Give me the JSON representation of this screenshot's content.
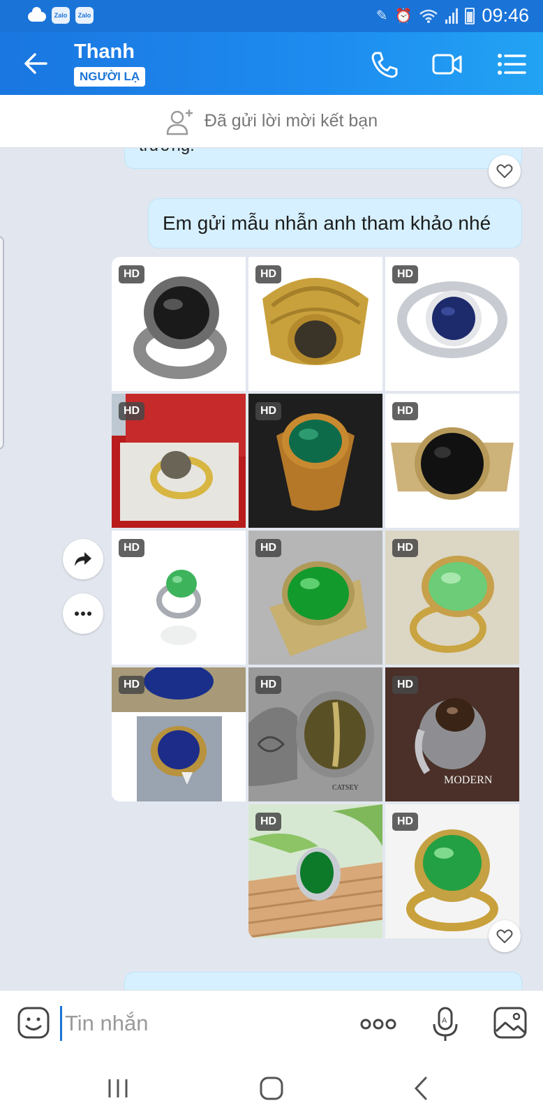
{
  "status_bar": {
    "time": "09:46",
    "app_icon_1": "Zalo",
    "app_icon_2": "Zalo"
  },
  "header": {
    "name": "Thanh",
    "badge": "NGƯỜI LẠ"
  },
  "friend_request": {
    "text": "Đã gửi lời mời kết bạn"
  },
  "messages": {
    "previous_partial": "trường.",
    "text_message": "Em gửi mẫu nhẫn anh tham khảo nhé"
  },
  "photos": {
    "hd_label": "HD",
    "count": 14,
    "items": [
      "black onyx ring",
      "gold star sapphire ring",
      "blue sapphire ring",
      "gold ring in red box",
      "green jade gold ring",
      "black stone gold ring",
      "green jade silver ring",
      "green jade gold ring 2",
      "light jade gold ring",
      "blue stone ring",
      "cat eye celtic ring",
      "star stone silver ring",
      "green jade ring on wood",
      "green jade gold ring 3"
    ]
  },
  "input": {
    "placeholder": "Tin nhắn"
  },
  "colors": {
    "header_blue": "#1a74d8",
    "bubble": "#d6f0ff",
    "chat_bg": "#e2e7ef"
  },
  "icons": [
    "back-arrow-icon",
    "phone-icon",
    "video-icon",
    "menu-icon",
    "add-friend-icon",
    "heart-icon",
    "share-icon",
    "more-icon",
    "emoji-icon",
    "mic-icon",
    "image-icon"
  ]
}
